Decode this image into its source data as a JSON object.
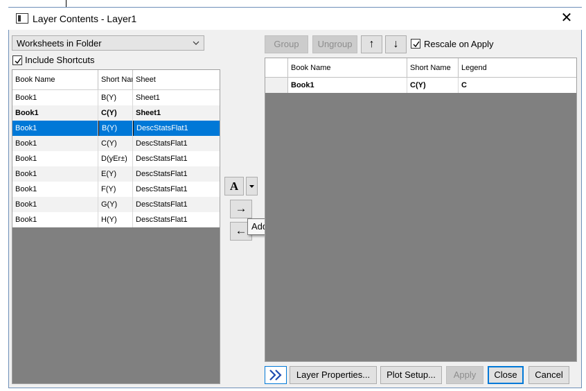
{
  "window": {
    "title": "Layer Contents - Layer1"
  },
  "left": {
    "source_select": "Worksheets in Folder",
    "include_shortcuts": {
      "label": "Include Shortcuts",
      "checked": true
    },
    "columns": [
      "Book Name",
      "Short Nar",
      "Sheet"
    ],
    "rows": [
      {
        "book": "Book1",
        "short": "B(Y)",
        "sheet": "Sheet1",
        "style": "normal"
      },
      {
        "book": "Book1",
        "short": "C(Y)",
        "sheet": "Sheet1",
        "style": "bold"
      },
      {
        "book": "Book1",
        "short": "B(Y)",
        "sheet": "DescStatsFlat1",
        "style": "selected"
      },
      {
        "book": "Book1",
        "short": "C(Y)",
        "sheet": "DescStatsFlat1",
        "style": "normal"
      },
      {
        "book": "Book1",
        "short": "D(yEr±)",
        "sheet": "DescStatsFlat1",
        "style": "normal"
      },
      {
        "book": "Book1",
        "short": "E(Y)",
        "sheet": "DescStatsFlat1",
        "style": "normal"
      },
      {
        "book": "Book1",
        "short": "F(Y)",
        "sheet": "DescStatsFlat1",
        "style": "normal"
      },
      {
        "book": "Book1",
        "short": "G(Y)",
        "sheet": "DescStatsFlat1",
        "style": "normal"
      },
      {
        "book": "Book1",
        "short": "H(Y)",
        "sheet": "DescStatsFlat1",
        "style": "normal"
      }
    ]
  },
  "middle": {
    "plot_type_button": "A",
    "add_arrow": "→",
    "remove_arrow": "←",
    "tooltip": "Add plot"
  },
  "right": {
    "toolbar": {
      "group": "Group",
      "ungroup": "Ungroup",
      "up_arrow": "↑",
      "down_arrow": "↓",
      "rescale": {
        "label": "Rescale on Apply",
        "checked": true
      }
    },
    "columns": [
      "Book Name",
      "Short Name",
      "Legend"
    ],
    "rows": [
      {
        "book": "Book1",
        "short": "C(Y)",
        "legend": "C"
      }
    ]
  },
  "footer": {
    "expand": "»",
    "layer_properties": "Layer Properties...",
    "plot_setup": "Plot Setup...",
    "apply": "Apply",
    "close": "Close",
    "cancel": "Cancel"
  }
}
